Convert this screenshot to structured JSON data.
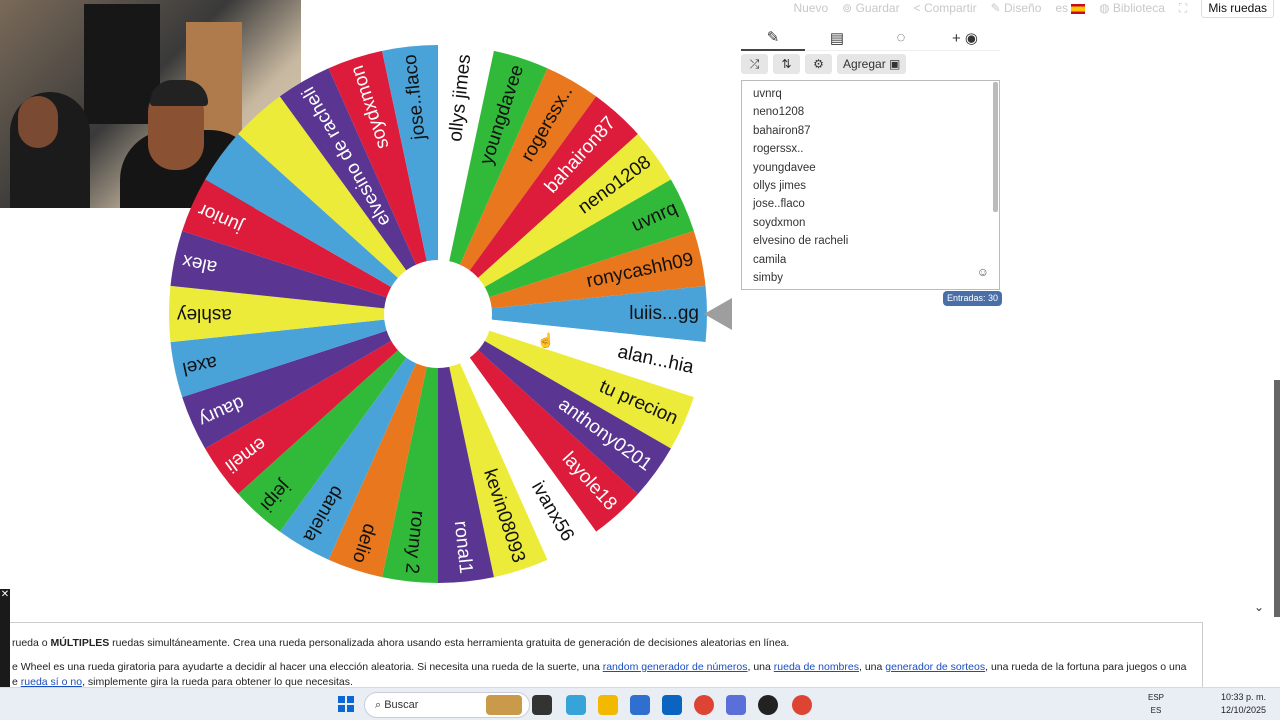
{
  "topbar": {
    "items": [
      "Nuevo",
      "Guardar",
      "Compartir",
      "Diseño",
      "es",
      "Biblioteca"
    ],
    "mis_ruedas": "Mis ruedas"
  },
  "wheel": {
    "colors": {
      "blue": "#4aa3d8",
      "white": "#ffffff",
      "green": "#31ba3a",
      "orange": "#e8771d",
      "red": "#dc1c3a",
      "yellow": "#eceb3a",
      "purple": "#5a3591"
    },
    "segments": [
      {
        "name": "luiis...gg",
        "color": "#4aa3d8"
      },
      {
        "name": "alan...hia",
        "color": "#ffffff"
      },
      {
        "name": "tu precion",
        "color": "#eceb3a"
      },
      {
        "name": "anthony0201",
        "color": "#5a3591"
      },
      {
        "name": "layole18",
        "color": "#dc1c3a"
      },
      {
        "name": "ivanx56",
        "color": "#ffffff"
      },
      {
        "name": "kevin08093",
        "color": "#eceb3a"
      },
      {
        "name": "ronal1",
        "color": "#5a3591"
      },
      {
        "name": "ronny 2",
        "color": "#31ba3a"
      },
      {
        "name": "delio",
        "color": "#e8771d"
      },
      {
        "name": "daniela",
        "color": "#4aa3d8"
      },
      {
        "name": "jeipi",
        "color": "#31ba3a"
      },
      {
        "name": "emeli",
        "color": "#dc1c3a"
      },
      {
        "name": "daury",
        "color": "#5a3591"
      },
      {
        "name": "axel",
        "color": "#4aa3d8"
      },
      {
        "name": "ashley",
        "color": "#eceb3a"
      },
      {
        "name": "alex",
        "color": "#5a3591"
      },
      {
        "name": "junior",
        "color": "#dc1c3a"
      },
      {
        "name": "",
        "color": "#4aa3d8"
      },
      {
        "name": "",
        "color": "#eceb3a"
      },
      {
        "name": "elvesino de racheli",
        "color": "#5a3591"
      },
      {
        "name": "soydxmon",
        "color": "#dc1c3a"
      },
      {
        "name": "jose..flaco",
        "color": "#4aa3d8"
      },
      {
        "name": "ollys jimes",
        "color": "#ffffff"
      },
      {
        "name": "youngdavee",
        "color": "#31ba3a"
      },
      {
        "name": "rogerssx..",
        "color": "#e8771d"
      },
      {
        "name": "bahairon87",
        "color": "#dc1c3a"
      },
      {
        "name": "neno1208",
        "color": "#eceb3a"
      },
      {
        "name": "uvnrq",
        "color": "#31ba3a"
      },
      {
        "name": "ronycashh09",
        "color": "#e8771d"
      }
    ]
  },
  "panel": {
    "tabs": [
      "edit-icon",
      "results-icon",
      "hide-icon",
      "add-color-icon"
    ],
    "tools": {
      "shuffle": "⤮",
      "sort": "⇅",
      "settings": "⚙",
      "add_label": "Agregar"
    },
    "entries": [
      "uvnrq",
      "neno1208",
      "bahairon87",
      "rogerssx..",
      "youngdavee",
      "ollys jimes",
      "jose..flaco",
      "soydxmon",
      "elvesino de racheli",
      "camila",
      "simby"
    ],
    "count_label": "Entradas: 30"
  },
  "bottom": {
    "line1_pre": "rueda o ",
    "line1_bold": "MÚLTIPLES",
    "line1_post": " ruedas simultáneamente. Crea una rueda personalizada ahora usando esta herramienta gratuita de generación de decisiones aleatorias en línea.",
    "line2_a": "e Wheel es una rueda giratoria para ayudarte a decidir al hacer una elección aleatoria. Si necesita una rueda de la suerte, una ",
    "link1": "random generador de números",
    "line2_b": ", una ",
    "link2": "rueda de nombres",
    "line2_c": ", una ",
    "link3": "generador de sorteos",
    "line2_d": ", una rueda de la fortuna para juegos o una",
    "line3_a": "e ",
    "link4": "rueda sí o no",
    "line3_b": ", simplemente gira la rueda para obtener lo que necesitas."
  },
  "taskbar": {
    "search_placeholder": "Buscar",
    "lang_top": "ESP",
    "lang_bottom": "ES",
    "time": "10:33 p. m.",
    "date": "12/10/2025"
  }
}
